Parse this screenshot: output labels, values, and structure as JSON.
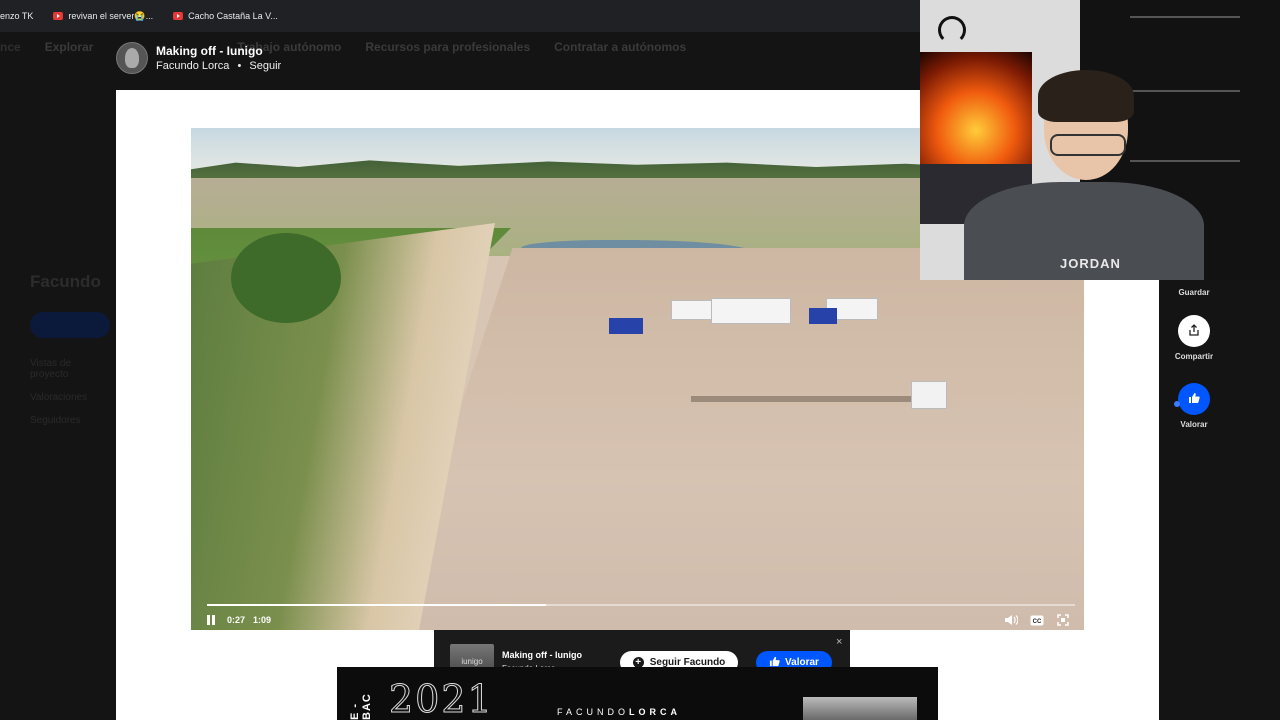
{
  "bookmarks": [
    {
      "label": "enzo TK",
      "icon": "none"
    },
    {
      "label": "revivan el server😭...",
      "icon": "youtube-icon"
    },
    {
      "label": "Cacho Castaña La V...",
      "icon": "youtube-icon"
    }
  ],
  "background_page": {
    "nav": [
      "nce",
      "Explorar",
      "Trabajo autónomo",
      "Recursos para profesionales",
      "Contratar a autónomos"
    ],
    "profile_name": "Facundo",
    "stats": [
      "Vistas de proyecto",
      "Valoraciones",
      "Seguidores"
    ]
  },
  "project": {
    "title": "Making off - Iunigo",
    "author": "Facundo Lorca",
    "separator": "•",
    "follow_label": "Seguir"
  },
  "video": {
    "current_time": "0:27",
    "duration": "1:09",
    "progress": 0.39
  },
  "rail": {
    "save_label": "Guardar",
    "share_label": "Compartir",
    "rate_label": "Valorar"
  },
  "follow_bar": {
    "thumb_text": "iunigo",
    "title": "Making off - Iunigo",
    "author": "Facundo Lorca",
    "follow_button": "Seguir Facundo",
    "rate_button": "Valorar",
    "close": "×"
  },
  "next_image": {
    "vertical_text": "E - BAC",
    "year": "2021",
    "credit_first": "FACUNDO",
    "credit_last": "LORCA"
  },
  "webcam": {
    "shirt_text": "JORDAN"
  },
  "colors": {
    "accent_blue": "#0057ff",
    "dark_bg": "#141414"
  }
}
